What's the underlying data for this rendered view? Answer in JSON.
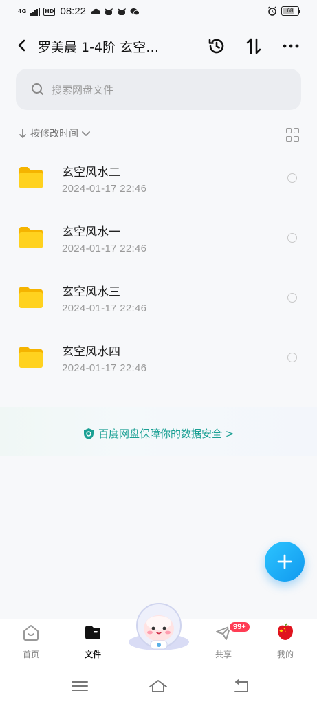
{
  "status": {
    "network": "4G",
    "hd": "HD",
    "time": "08:22",
    "battery": "68"
  },
  "header": {
    "title": "罗美晨 1-4阶 玄空…"
  },
  "search": {
    "placeholder": "搜索网盘文件"
  },
  "sort": {
    "label": "按修改时间"
  },
  "files": [
    {
      "name": "玄空风水二",
      "date": "2024-01-17  22:46"
    },
    {
      "name": "玄空风水一",
      "date": "2024-01-17  22:46"
    },
    {
      "name": "玄空风水三",
      "date": "2024-01-17  22:46"
    },
    {
      "name": "玄空风水四",
      "date": "2024-01-17  22:46"
    }
  ],
  "banner": {
    "text": "百度网盘保障你的数据安全 >"
  },
  "tabs": {
    "home": "首页",
    "files": "文件",
    "share": "共享",
    "share_badge": "99+",
    "mine": "我的"
  },
  "colors": {
    "accent": "#1ba094",
    "fab": "#1aa6f5",
    "folder": "#ffcc1a",
    "badge": "#ff3d55"
  }
}
